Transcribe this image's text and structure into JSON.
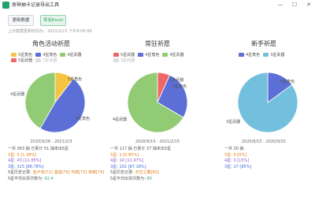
{
  "window": {
    "title": "原神抽卡记录导出工具",
    "min": "—",
    "max": "☐",
    "close": "✕"
  },
  "toolbar": {
    "update_label": "更新数据",
    "export_label": "导出Excel",
    "last_update": "上次数据更新时间为：2021/2/15 下午8:05:49"
  },
  "colors": {
    "gold": "#f4c542",
    "purple": "#5b6fd6",
    "blue": "#73c0de",
    "green": "#91cc75",
    "red": "#ee6666",
    "orange": "#e0821e"
  },
  "legend_labels": {
    "star5_char": "5星角色",
    "star4_char": "4星角色",
    "star4_weapon": "4星武器",
    "star5_weapon": "5星武器",
    "star3_weapon": "3星武器"
  },
  "panels": [
    {
      "title": "角色活动祈愿",
      "date_range": "2020/9/28  -  2021/2/3",
      "labels": {
        "star5_char": "5星角色",
        "star4_char": "4星角色",
        "star4_weapon": "4星武器"
      },
      "stats": {
        "line1_a": "一共 363 抽 ",
        "line1_b": "已累计 51 抽未出5星",
        "line2_a": "5星: 5",
        "line2_b": "  [1.38%]",
        "line3_a": "4星: 43",
        "line3_b": "  [11.85%]",
        "line4_a": "3星: 315",
        "line4_b": "  [86.78%]",
        "line5_a": "5星历史记录: ",
        "line5_b": "迪卢克[72]  温迪[78]  可莉[73]  钟离[74]",
        "line6_a": "5星平均出货次数为: ",
        "line6_b": "62.4"
      }
    },
    {
      "title": "常驻祈愿",
      "date_range": "2020/9/15  -  2021/2/15",
      "labels": {
        "star5_char": "5星武器",
        "star4_char": "4星角色",
        "star4_weapon": "4星武器"
      },
      "stats": {
        "line1_a": "一共 117 抽 ",
        "line1_b": "已累计 37 抽未出5星",
        "line2_a": "5星: 1",
        "line2_b": "  [0.85%]",
        "line3_a": "4星: 14",
        "line3_b": "  [11.97%]",
        "line4_a": "3星: 102",
        "line4_b": "  [87.18%]",
        "line5_a": "5星历史记录: ",
        "line5_b": "天空之翼[80]",
        "line6_a": "5星平均出货次数为: ",
        "line6_b": "80"
      }
    },
    {
      "title": "新手祈愿",
      "date_range": "2020/9/15  -  2020/9/15",
      "labels": {
        "star4_char": "4星角色",
        "star3_weapon": "3星武器"
      },
      "stats": {
        "line1_a": "一共 20 抽",
        "line2_a": "5星: 0",
        "line2_b": "  [0%]",
        "line3_a": "4星: 3",
        "line3_b": "  [15%]",
        "line4_a": "3星: 17",
        "line4_b": "  [85%]"
      }
    }
  ],
  "chart_data": [
    {
      "type": "pie",
      "title": "角色活动祈愿",
      "series": [
        {
          "name": "5星角色",
          "value": 5
        },
        {
          "name": "4星角色",
          "value": 23
        },
        {
          "name": "4星武器",
          "value": 20
        }
      ]
    },
    {
      "type": "pie",
      "title": "常驻祈愿",
      "series": [
        {
          "name": "5星武器",
          "value": 1
        },
        {
          "name": "4星角色",
          "value": 4
        },
        {
          "name": "4星武器",
          "value": 10
        }
      ]
    },
    {
      "type": "pie",
      "title": "新手祈愿",
      "series": [
        {
          "name": "4星角色",
          "value": 3
        },
        {
          "name": "3星武器",
          "value": 17
        }
      ]
    }
  ]
}
